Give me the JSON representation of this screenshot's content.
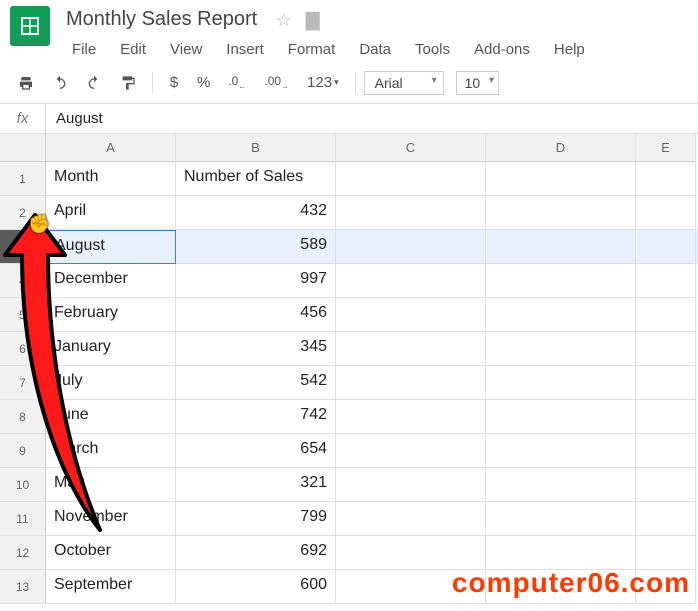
{
  "doc": {
    "title": "Monthly Sales Report"
  },
  "menu": {
    "file": "File",
    "edit": "Edit",
    "view": "View",
    "insert": "Insert",
    "format": "Format",
    "data": "Data",
    "tools": "Tools",
    "addons": "Add-ons",
    "help": "Help"
  },
  "toolbar": {
    "currency": "$",
    "percent": "%",
    "dec_dec": ".0",
    "dec_inc": ".00",
    "numfmt": "123",
    "font": "Arial",
    "size": "10"
  },
  "formula": {
    "label": "fx",
    "value": "August"
  },
  "columns": {
    "A": "A",
    "B": "B",
    "C": "C",
    "D": "D",
    "E": "E"
  },
  "row_labels": [
    "1",
    "2",
    "3",
    "4",
    "5",
    "6",
    "7",
    "8",
    "9",
    "10",
    "11",
    "12",
    "13"
  ],
  "selected_row_index": 2,
  "chart_data": {
    "type": "table",
    "title": "Monthly Sales Report",
    "columns": [
      "Month",
      "Number of Sales"
    ],
    "rows": [
      [
        "April",
        432
      ],
      [
        "August",
        589
      ],
      [
        "December",
        997
      ],
      [
        "February",
        456
      ],
      [
        "January",
        345
      ],
      [
        "July",
        542
      ],
      [
        "June",
        742
      ],
      [
        "March",
        654
      ],
      [
        "May",
        321
      ],
      [
        "November",
        799
      ],
      [
        "October",
        692
      ],
      [
        "September",
        600
      ]
    ]
  },
  "watermark": "computer06.com"
}
